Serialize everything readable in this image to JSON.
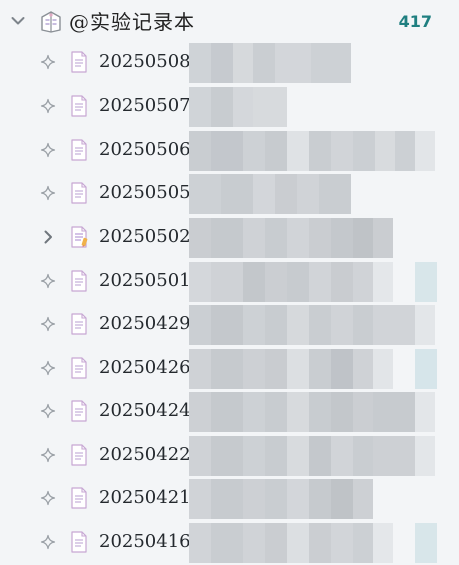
{
  "notebook": {
    "title": "@实验记录本",
    "count": "417",
    "expand_icon": "chevron-down-icon",
    "notebook_icon": "notebook-icon"
  },
  "items": [
    {
      "label": "20250508",
      "lead_icon": "sparkle-icon",
      "doc_icon": "document-icon"
    },
    {
      "label": "20250507",
      "lead_icon": "sparkle-icon",
      "doc_icon": "document-icon"
    },
    {
      "label": "20250506",
      "lead_icon": "sparkle-icon",
      "doc_icon": "document-icon"
    },
    {
      "label": "20250505",
      "lead_icon": "sparkle-icon",
      "doc_icon": "document-icon"
    },
    {
      "label": "20250502",
      "lead_icon": "chevron-right-icon",
      "doc_icon": "document-colored-icon"
    },
    {
      "label": "20250501",
      "lead_icon": "sparkle-icon",
      "doc_icon": "document-icon"
    },
    {
      "label": "20250429",
      "lead_icon": "sparkle-icon",
      "doc_icon": "document-icon"
    },
    {
      "label": "20250426",
      "lead_icon": "sparkle-icon",
      "doc_icon": "document-icon"
    },
    {
      "label": "20250424",
      "lead_icon": "sparkle-icon",
      "doc_icon": "document-icon"
    },
    {
      "label": "20250422",
      "lead_icon": "sparkle-icon",
      "doc_icon": "document-icon"
    },
    {
      "label": "20250421",
      "lead_icon": "sparkle-icon",
      "doc_icon": "document-icon"
    },
    {
      "label": "20250416",
      "lead_icon": "sparkle-icon",
      "doc_icon": "document-icon"
    }
  ],
  "colors": {
    "background": "#f3f5f7",
    "count": "#1f7f80",
    "text": "#24292e",
    "icon_gray": "#a0a6ad",
    "doc_accent": "#c9a7d6"
  }
}
